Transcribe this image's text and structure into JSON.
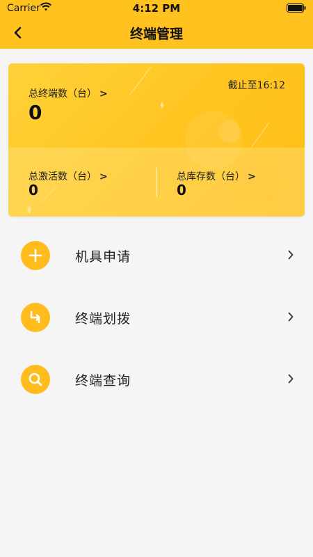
{
  "status_bar": {
    "carrier": "Carrier",
    "time": "4:12 PM"
  },
  "nav": {
    "title": "终端管理"
  },
  "summary": {
    "total_label": "总终端数（台）",
    "total_value": "0",
    "as_of": "截止至16:12",
    "activated_label": "总激活数（台）",
    "activated_value": "0",
    "inventory_label": "总库存数（台）",
    "inventory_value": "0"
  },
  "menu": [
    {
      "label": "机具申请",
      "icon": "plus-icon"
    },
    {
      "label": "终端划拨",
      "icon": "transfer-icon"
    },
    {
      "label": "终端查询",
      "icon": "search-icon"
    }
  ],
  "colors": {
    "primary": "#ffc21f",
    "background": "#f5f5f5"
  }
}
